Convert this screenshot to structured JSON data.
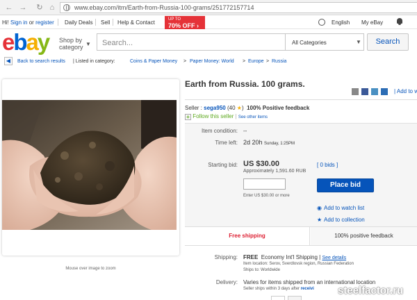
{
  "browser": {
    "url": "www.ebay.com/itm/Earth-from-Russia-100-grams/251772157714"
  },
  "topbar": {
    "greeting": "Hi!",
    "signin": "Sign in",
    "or": "or",
    "register": "register",
    "daily_deals": "Daily Deals",
    "sell": "Sell",
    "help": "Help & Contact",
    "promo_line1": "UP TO",
    "promo_line2": "70% OFF ›",
    "language": "English",
    "my_ebay": "My eBay"
  },
  "header": {
    "logo_letters": [
      "e",
      "b",
      "a",
      "y"
    ],
    "shop_by_line1": "Shop by",
    "shop_by_line2": "category",
    "search_placeholder": "Search...",
    "category_select": "All Categories",
    "search_button": "Search"
  },
  "breadcrumb": {
    "back": "Back to search results",
    "listed_in": "| Listed in category:",
    "path": [
      "Coins & Paper Money",
      "Paper Money: World",
      "Europe",
      "Russia"
    ],
    "separator": ">"
  },
  "listing": {
    "title": "Earth from Russia. 100 grams.",
    "add_to": "| Add to w",
    "seller_label": "Seller :",
    "seller_name": "sega950",
    "feedback_score": "(40",
    "feedback_close": ")",
    "positive_feedback": "100% Positive feedback",
    "follow_seller": "Follow this seller",
    "see_other": "See other items",
    "item_condition_label": "Item condition:",
    "item_condition": "--",
    "time_left_label": "Time left:",
    "time_left": "2d 20h",
    "time_left_detail": "Sunday, 1:25PM",
    "starting_bid_label": "Starting bid:",
    "starting_bid": "US $30.00",
    "approx": "Approximately",
    "approx_value": "1,591.60 RUB",
    "bids": "[ 0 bids ]",
    "enter_bid": "Enter US $30.00 or more",
    "place_bid": "Place bid",
    "add_watch": "Add to watch list",
    "add_collection": "Add to collection",
    "free_shipping": "Free shipping",
    "positive_strip": "100% positive feedback",
    "shipping_label": "Shipping:",
    "shipping_free": "FREE",
    "shipping_method": "Economy Int'l Shipping |",
    "see_details": "See details",
    "item_location": "Item location:  Serov, Sverdlovsk region, Russian Federation",
    "ships_to": "Ships to:  Worldwide",
    "delivery_label": "Delivery:",
    "delivery_text": "Varies for items shipped from an international location",
    "seller_ships": "Seller ships within 3 days after",
    "receiving": "receivi",
    "mouse_over": "Mouse over image to zoom"
  },
  "watermark": "steelfactor.ru",
  "colors": {
    "ebay_red": "#e53238",
    "ebay_blue": "#0064d2",
    "ebay_yellow": "#f5af02",
    "ebay_green": "#86b817",
    "link": "#0654ba",
    "free_shipping": "#dd1e31"
  }
}
